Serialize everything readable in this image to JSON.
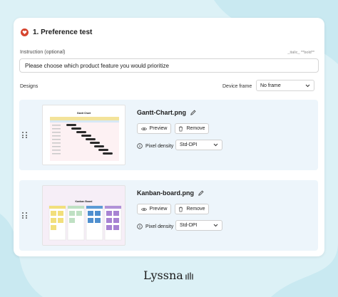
{
  "header": {
    "title": "1. Preference test",
    "icon": "heart-icon",
    "icon_color": "#d6452f"
  },
  "instruction": {
    "label": "Instruction (optional)",
    "markdown_hint": "_italic_ **bold**",
    "value": "Please choose which product feature you would prioritize"
  },
  "designs": {
    "label": "Designs",
    "device_frame_label": "Device frame",
    "device_frame_value": "No frame",
    "items": [
      {
        "filename": "Gantt-Chart.png",
        "thumb_title": "Gantt Chart",
        "preview_label": "Preview",
        "remove_label": "Remove",
        "density_label": "Pixel density",
        "density_value": "Std-DPI"
      },
      {
        "filename": "Kanban-board.png",
        "thumb_title": "Kanban Board",
        "preview_label": "Preview",
        "remove_label": "Remove",
        "density_label": "Pixel density",
        "density_value": "Std-DPI"
      }
    ]
  },
  "brand": {
    "name": "Lyssna"
  },
  "colors": {
    "background": "#dcf1f6",
    "row_bg": "#edf5fb",
    "accent": "#d6452f"
  }
}
